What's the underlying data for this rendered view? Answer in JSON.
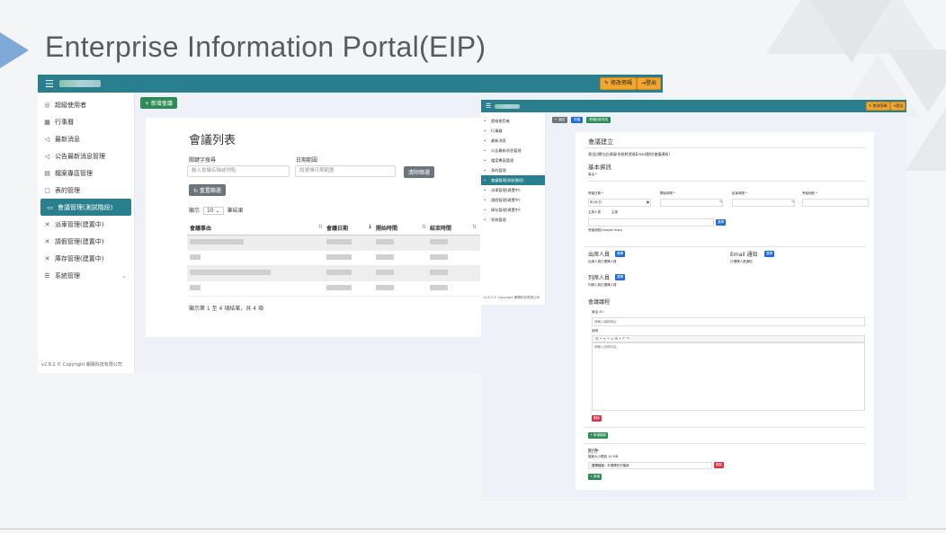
{
  "slide": {
    "title": "Enterprise Information Portal(EIP)"
  },
  "screen1": {
    "topbar": {
      "btn_password": "修改密碼",
      "btn_logout": "登出"
    },
    "sidebar": [
      {
        "label": "超級使用者",
        "icon": "user-circle-icon"
      },
      {
        "label": "行事曆",
        "icon": "calendar-icon"
      },
      {
        "label": "最新消息",
        "icon": "megaphone-icon"
      },
      {
        "label": "公告最新消息管理",
        "icon": "megaphone-icon"
      },
      {
        "label": "檔案專區管理",
        "icon": "file-icon"
      },
      {
        "label": "表的管理",
        "icon": "clipboard-icon"
      },
      {
        "label": "會議管理(測試階段)",
        "icon": "meeting-icon",
        "active": true
      },
      {
        "label": "派車管理(建置中)",
        "icon": "tools-icon"
      },
      {
        "label": "請假管理(建置中)",
        "icon": "tools-icon"
      },
      {
        "label": "庫存管理(建置中)",
        "icon": "tools-icon"
      },
      {
        "label": "系統管理",
        "icon": "list-icon"
      }
    ],
    "footer": "v2.8.2 © Copyright 朝陽科技有限公司",
    "add_button": "+ 新增會議",
    "page_title": "會議列表",
    "filter": {
      "keyword_label": "關鍵字搜尋",
      "keyword_placeholder": "輸入會議名稱或地點",
      "date_label": "日期範圍",
      "date_placeholder": "請選擇日期範圍",
      "clear_btn": "清除篩選",
      "reset_btn": "↻ 重置篩選"
    },
    "page_size": {
      "prefix": "顯示",
      "value": "10",
      "suffix": "筆結果"
    },
    "table": {
      "headers": [
        "會議事由",
        "會議日期",
        "開始時間",
        "結束時間"
      ]
    },
    "summary": "顯示第 1 至 4 項結果，共 4 項"
  },
  "screen2": {
    "topbar": {
      "btn_password": "修改密碼",
      "btn_logout": "登出"
    },
    "sidebar": [
      {
        "label": "超級使用者"
      },
      {
        "label": "行事曆"
      },
      {
        "label": "最新消息"
      },
      {
        "label": "公告最新消息管理"
      },
      {
        "label": "檔案專區管理"
      },
      {
        "label": "表的管理"
      },
      {
        "label": "會議管理(測試階段)",
        "active": true
      },
      {
        "label": "派車管理(建置中)"
      },
      {
        "label": "請假管理(建置中)"
      },
      {
        "label": "庫存管理(建置中)"
      },
      {
        "label": "系統管理"
      }
    ],
    "footer": "v2.8.2 © Copyright 朝陽科技有限公司",
    "toolbar": [
      "← 返回",
      "存檔",
      "會議記錄完成"
    ],
    "form_title": "會議建立",
    "notice": "表(此)欄位必須填(系統將透過Email通知(會議通知)",
    "basic_info": "基本資訊",
    "fields": [
      "會議日期 *",
      "開始時間 *",
      "結束時間 *",
      "會議地點 *"
    ],
    "date_value": "年/月/日",
    "host_label": "主席人員",
    "host_value": "主席",
    "select_btn": "選擇",
    "google_note": "會議地點(Google map)",
    "attendees": {
      "title": "出席人員",
      "btn": "選擇",
      "note": "出席人員已選擇人員"
    },
    "email_notify": {
      "title": "Email 通知",
      "btn": "選擇",
      "note": "已選擇人員通知"
    },
    "observers": {
      "title": "列席人員",
      "btn": "選擇",
      "note": "列席人員已選擇人員"
    },
    "agenda": {
      "title": "會議議程",
      "item_label": "案由 #1",
      "item_placeholder": "請輸入議程案由",
      "desc_label": "說明",
      "desc_placeholder": "請輸入說明內容",
      "delete_btn": "刪除",
      "add_btn": "+ 新增議程"
    },
    "attachments": {
      "title": "附件",
      "note": "檔案大小限制 10 MB",
      "file_btn": "選擇檔案",
      "file_status": "未選擇任何檔案",
      "delete_btn": "刪除",
      "add_btn": "+ 新增"
    }
  }
}
